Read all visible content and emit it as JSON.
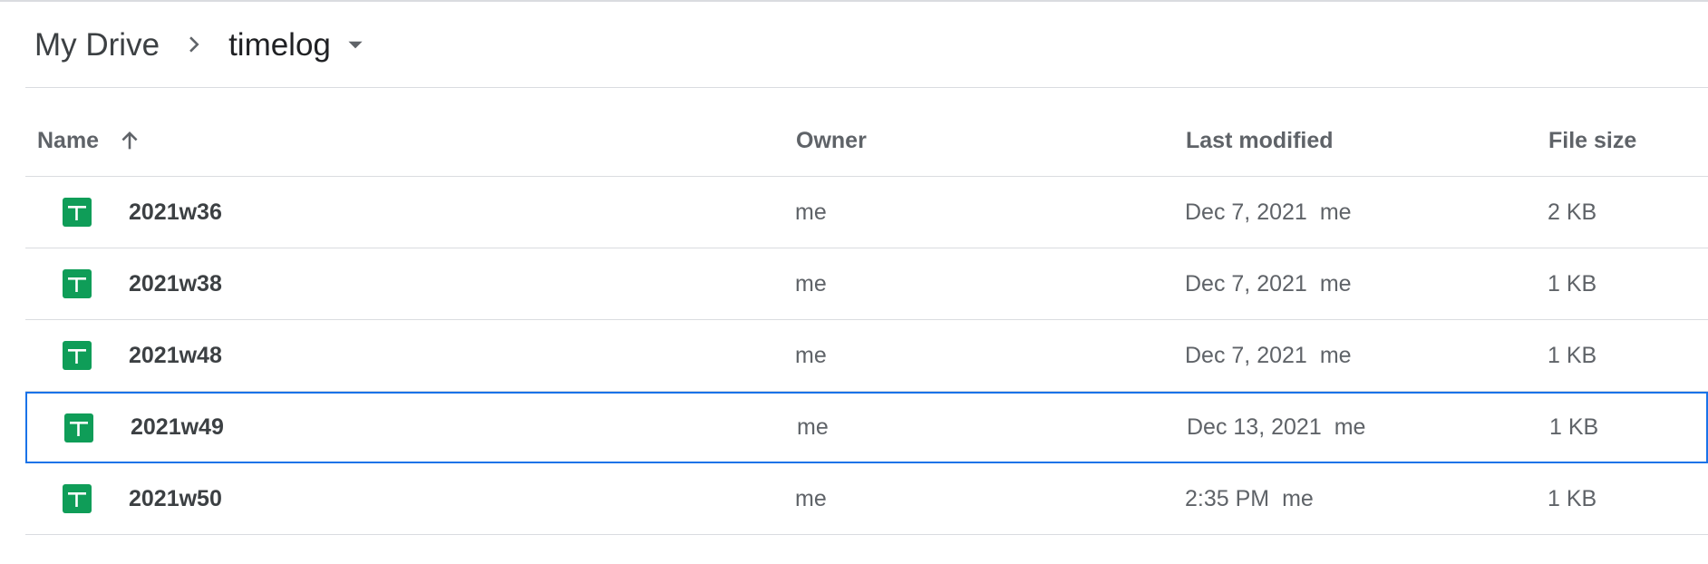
{
  "breadcrumb": {
    "root": "My Drive",
    "current": "timelog",
    "separator_icon": "chevron-right-icon",
    "dropdown_icon": "arrow-drop-down-icon"
  },
  "table": {
    "headers": {
      "name": "Name",
      "owner": "Owner",
      "last_modified": "Last modified",
      "file_size": "File size"
    },
    "sort": {
      "column": "name",
      "direction": "ascending",
      "icon": "arrow-up-icon"
    },
    "rows": [
      {
        "icon": "google-sheets-icon",
        "name": "2021w36",
        "owner": "me",
        "modified_date": "Dec 7, 2021",
        "modified_by": "me",
        "size": "2 KB"
      },
      {
        "icon": "google-sheets-icon",
        "name": "2021w38",
        "owner": "me",
        "modified_date": "Dec 7, 2021",
        "modified_by": "me",
        "size": "1 KB"
      },
      {
        "icon": "google-sheets-icon",
        "name": "2021w48",
        "owner": "me",
        "modified_date": "Dec 7, 2021",
        "modified_by": "me",
        "size": "1 KB"
      },
      {
        "icon": "google-sheets-icon",
        "name": "2021w49",
        "owner": "me",
        "modified_date": "Dec 13, 2021",
        "modified_by": "me",
        "size": "1 KB",
        "selected": true
      },
      {
        "icon": "google-sheets-icon",
        "name": "2021w50",
        "owner": "me",
        "modified_date": "2:35 PM",
        "modified_by": "me",
        "size": "1 KB"
      }
    ]
  },
  "colors": {
    "sheets_green": "#0f9d58",
    "selection_blue": "#1a73e8",
    "divider": "#dadce0",
    "secondary_text": "#5f6368"
  }
}
